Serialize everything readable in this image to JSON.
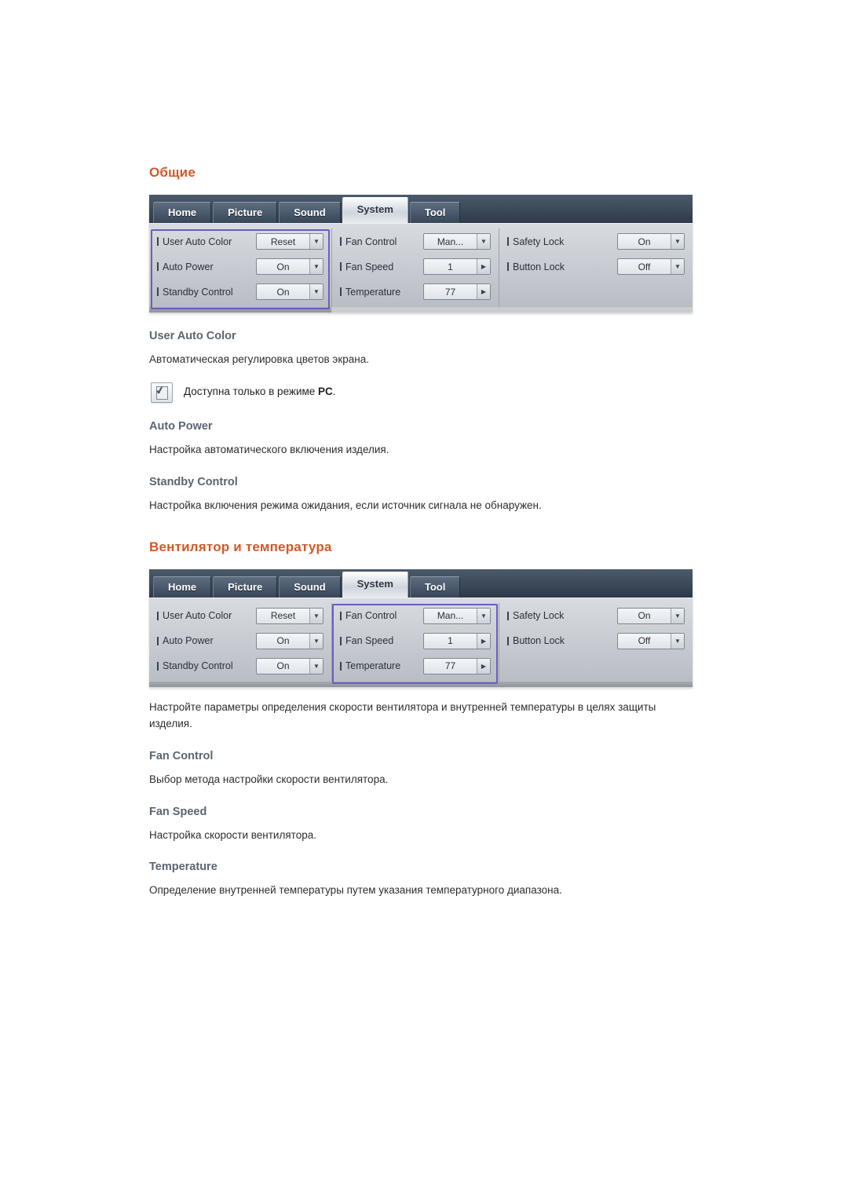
{
  "sections": [
    {
      "title": "Общие",
      "osd_id": "osd-general",
      "highlight": "column1",
      "subsections": [
        {
          "heading": "User Auto Color",
          "paragraphs": [
            "Автоматическая регулировка цветов экрана."
          ],
          "note": {
            "icon": "note-pencil-icon",
            "text_before": "Доступна только в режиме ",
            "text_bold": "PC",
            "text_after": "."
          }
        },
        {
          "heading": "Auto Power",
          "paragraphs": [
            "Настройка автоматического включения изделия."
          ]
        },
        {
          "heading": "Standby Control",
          "paragraphs": [
            "Настройка включения режима ожидания, если источник сигнала не обнаружен."
          ]
        }
      ]
    },
    {
      "title": "Вентилятор и температура",
      "osd_id": "osd-fan",
      "highlight": "column2",
      "intro": "Настройте параметры определения скорости вентилятора и внутренней температуры в целях защиты изделия.",
      "subsections": [
        {
          "heading": "Fan Control",
          "paragraphs": [
            "Выбор метода настройки скорости вентилятора."
          ]
        },
        {
          "heading": "Fan Speed",
          "paragraphs": [
            "Настройка скорости вентилятора."
          ]
        },
        {
          "heading": "Temperature",
          "paragraphs": [
            "Определение внутренней температуры путем указания температурного диапазона."
          ]
        }
      ]
    }
  ],
  "osd": {
    "tabs": [
      {
        "label": "Home",
        "active": false
      },
      {
        "label": "Picture",
        "active": false
      },
      {
        "label": "Sound",
        "active": false
      },
      {
        "label": "System",
        "active": true
      },
      {
        "label": "Tool",
        "active": false
      }
    ],
    "columns": [
      {
        "name": "general",
        "rows": [
          {
            "label": "User Auto Color",
            "value": "Reset",
            "control": "dropdown"
          },
          {
            "label": "Auto Power",
            "value": "On",
            "control": "dropdown"
          },
          {
            "label": "Standby Control",
            "value": "On",
            "control": "dropdown"
          }
        ]
      },
      {
        "name": "fan-temperature",
        "rows": [
          {
            "label": "Fan Control",
            "value": "Man...",
            "control": "dropdown"
          },
          {
            "label": "Fan Speed",
            "value": "1",
            "control": "stepper"
          },
          {
            "label": "Temperature",
            "value": "77",
            "control": "stepper"
          }
        ]
      },
      {
        "name": "lock",
        "rows": [
          {
            "label": "Safety Lock",
            "value": "On",
            "control": "dropdown"
          },
          {
            "label": "Button Lock",
            "value": "Off",
            "control": "dropdown"
          }
        ]
      }
    ],
    "accent_highlight_color": "#6a5fbb",
    "icons": {
      "dropdown": "chevron-down-icon",
      "stepper": "chevron-right-icon"
    }
  }
}
